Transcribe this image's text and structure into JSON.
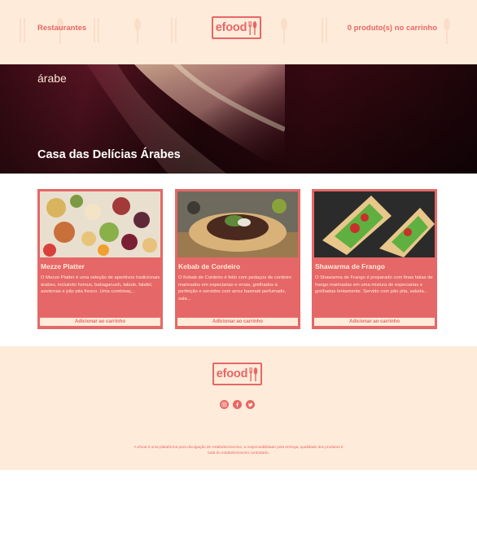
{
  "header": {
    "restaurants_link": "Restaurantes",
    "logo_text": "efood",
    "cart_text": "0 produto(s) no carrinho"
  },
  "hero": {
    "cuisine": "árabe",
    "restaurant_name": "Casa das Delícias Árabes"
  },
  "products": [
    {
      "title": "Mezze Platter",
      "description": "O Mezze Platter é uma seleção de aperitivos tradicionais árabes, incluindo homus, babaganush, tabule, falafel, azeitonas e pão pita fresco. Uma combinaç...",
      "button": "Adicionar ao carrinho"
    },
    {
      "title": "Kebab de Cordeiro",
      "description": "O Kebab de Cordeiro é feito com pedaços de cordeiro marinados em especiarias e ervas, grelhados à perfeição e servidos com arroz basmati perfumado, sala...",
      "button": "Adicionar ao carrinho"
    },
    {
      "title": "Shawarma de Frango",
      "description": "O Shawarma de Frango é preparado com finas fatias de frango marinadas em uma mistura de especiarias e grelhadas lentamente. Servido com pão pita, salada...",
      "button": "Adicionar ao carrinho"
    }
  ],
  "footer": {
    "logo_text": "efood",
    "socials": [
      "instagram-icon",
      "facebook-icon",
      "twitter-icon"
    ],
    "disclaimer": "A efood é uma plataforma para divulgação de estabelecimentos, a responsabilidade pela entrega, qualidade dos produtos é toda do estabelecimento contratado."
  },
  "colors": {
    "primary": "#E66767",
    "cream": "#FFEBD9"
  }
}
